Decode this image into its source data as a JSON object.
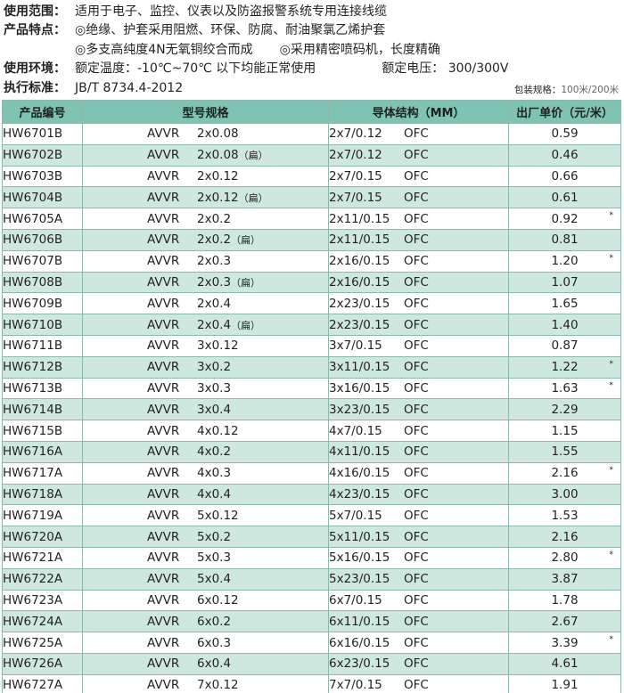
{
  "info": {
    "scope_label": "使用范围：",
    "scope_value": "适用于电子、监控、仪表以及防盗报警系统专用连接线缆",
    "features_label": "产品特点：",
    "features_line1": "◎绝缘、护套采用阻燃、环保、防腐、耐油聚氯乙烯护套",
    "features_line2a": "◎多支高纯度4N无氧铜绞合而成",
    "features_line2b": "◎采用精密喷码机，长度精确",
    "env_label": "使用环境：",
    "env_value": "额定温度：-10℃~70℃ 以下均能正常使用",
    "voltage_value": "额定电压：  300/300V",
    "std_label": "执行标准：",
    "std_value": "JB/T 8734.4-2012"
  },
  "pack": {
    "label": "包装规格：",
    "value1": "100米",
    "sep": "/",
    "value2": "200米"
  },
  "table": {
    "headers": {
      "code": "产品编号",
      "model": "型号规格",
      "conductor": "导体结构（MM）",
      "price": "出厂单价（元/米）"
    },
    "rows": [
      {
        "code": "HW6701B",
        "type": "AVVR",
        "size": "2x0.08",
        "flat": "",
        "struct": "2x7/0.12",
        "material": "OFC",
        "price": "0.59",
        "star": ""
      },
      {
        "code": "HW6702B",
        "type": "AVVR",
        "size": "2x0.08",
        "flat": "（扁）",
        "struct": "2x7/0.12",
        "material": "OFC",
        "price": "0.46",
        "star": ""
      },
      {
        "code": "HW6703B",
        "type": "AVVR",
        "size": "2x0.12",
        "flat": "",
        "struct": "2x7/0.15",
        "material": "OFC",
        "price": "0.66",
        "star": ""
      },
      {
        "code": "HW6704B",
        "type": "AVVR",
        "size": "2x0.12",
        "flat": "（扁）",
        "struct": "2x7/0.15",
        "material": "OFC",
        "price": "0.61",
        "star": ""
      },
      {
        "code": "HW6705A",
        "type": "AVVR",
        "size": "2x0.2",
        "flat": "",
        "struct": "2x11/0.15",
        "material": "OFC",
        "price": "0.92",
        "star": "*"
      },
      {
        "code": "HW6706B",
        "type": "AVVR",
        "size": "2x0.2",
        "flat": "（扁）",
        "struct": "2x11/0.15",
        "material": "OFC",
        "price": "0.81",
        "star": ""
      },
      {
        "code": "HW6707B",
        "type": "AVVR",
        "size": "2x0.3",
        "flat": "",
        "struct": "2x16/0.15",
        "material": "OFC",
        "price": "1.20",
        "star": "*"
      },
      {
        "code": "HW6708B",
        "type": "AVVR",
        "size": "2x0.3",
        "flat": "（扁）",
        "struct": "2x16/0.15",
        "material": "OFC",
        "price": "1.07",
        "star": ""
      },
      {
        "code": "HW6709B",
        "type": "AVVR",
        "size": "2x0.4",
        "flat": "",
        "struct": "2x23/0.15",
        "material": "OFC",
        "price": "1.65",
        "star": ""
      },
      {
        "code": "HW6710B",
        "type": "AVVR",
        "size": "2x0.4",
        "flat": "（扁）",
        "struct": "2x23/0.15",
        "material": "OFC",
        "price": "1.40",
        "star": ""
      },
      {
        "code": "HW6711B",
        "type": "AVVR",
        "size": "3x0.12",
        "flat": "",
        "struct": "3x7/0.15",
        "material": "OFC",
        "price": "0.87",
        "star": ""
      },
      {
        "code": "HW6712B",
        "type": "AVVR",
        "size": "3x0.2",
        "flat": "",
        "struct": "3x11/0.15",
        "material": "OFC",
        "price": "1.22",
        "star": "*"
      },
      {
        "code": "HW6713B",
        "type": "AVVR",
        "size": "3x0.3",
        "flat": "",
        "struct": "3x16/0.15",
        "material": "OFC",
        "price": "1.63",
        "star": "*"
      },
      {
        "code": "HW6714B",
        "type": "AVVR",
        "size": "3x0.4",
        "flat": "",
        "struct": "3x23/0.15",
        "material": "OFC",
        "price": "2.29",
        "star": ""
      },
      {
        "code": "HW6715B",
        "type": "AVVR",
        "size": "4x0.12",
        "flat": "",
        "struct": "4x7/0.15",
        "material": "OFC",
        "price": "1.15",
        "star": ""
      },
      {
        "code": "HW6716A",
        "type": "AVVR",
        "size": "4x0.2",
        "flat": "",
        "struct": "4x11/0.15",
        "material": "OFC",
        "price": "1.55",
        "star": ""
      },
      {
        "code": "HW6717A",
        "type": "AVVR",
        "size": "4x0.3",
        "flat": "",
        "struct": "4x16/0.15",
        "material": "OFC",
        "price": "2.16",
        "star": "*"
      },
      {
        "code": "HW6718A",
        "type": "AVVR",
        "size": "4x0.4",
        "flat": "",
        "struct": "4x23/0.15",
        "material": "OFC",
        "price": "3.00",
        "star": ""
      },
      {
        "code": "HW6719A",
        "type": "AVVR",
        "size": "5x0.12",
        "flat": "",
        "struct": "5x7/0.15",
        "material": "OFC",
        "price": "1.53",
        "star": ""
      },
      {
        "code": "HW6720A",
        "type": "AVVR",
        "size": "5x0.2",
        "flat": "",
        "struct": "5x11/0.15",
        "material": "OFC",
        "price": "2.16",
        "star": ""
      },
      {
        "code": "HW6721A",
        "type": "AVVR",
        "size": "5x0.3",
        "flat": "",
        "struct": "5x16/0.15",
        "material": "OFC",
        "price": "2.80",
        "star": "*"
      },
      {
        "code": "HW6722A",
        "type": "AVVR",
        "size": "5x0.4",
        "flat": "",
        "struct": "5x23/0.15",
        "material": "OFC",
        "price": "3.87",
        "star": ""
      },
      {
        "code": "HW6723A",
        "type": "AVVR",
        "size": "6x0.12",
        "flat": "",
        "struct": "6x7/0.15",
        "material": "OFC",
        "price": "1.78",
        "star": ""
      },
      {
        "code": "HW6724A",
        "type": "AVVR",
        "size": "6x0.2",
        "flat": "",
        "struct": "6x11/0.15",
        "material": "OFC",
        "price": "2.67",
        "star": ""
      },
      {
        "code": "HW6725A",
        "type": "AVVR",
        "size": "6x0.3",
        "flat": "",
        "struct": "6x16/0.15",
        "material": "OFC",
        "price": "3.39",
        "star": "*"
      },
      {
        "code": "HW6726A",
        "type": "AVVR",
        "size": "6x0.4",
        "flat": "",
        "struct": "6x23/0.15",
        "material": "OFC",
        "price": "4.61",
        "star": ""
      },
      {
        "code": "HW6727A",
        "type": "AVVR",
        "size": "7x0.12",
        "flat": "",
        "struct": "7x7/0.15",
        "material": "OFC",
        "price": "1.91",
        "star": ""
      }
    ]
  },
  "colors": {
    "header_bg": "#7fc4b2",
    "alt_row_bg": "#cfe8df",
    "border": "#8fb8ad"
  }
}
